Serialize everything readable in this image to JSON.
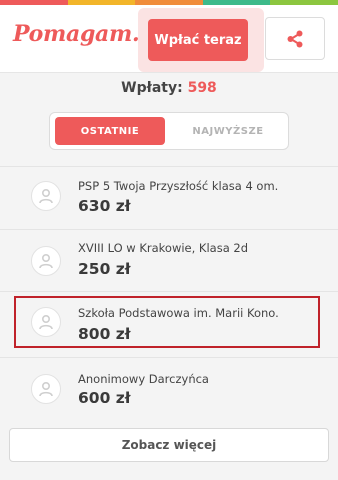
{
  "brand": {
    "logo": "Pomagam.pl",
    "stripe_colors": [
      "#ee5a5a",
      "#f2b52a",
      "#f08c3a",
      "#3dba8a",
      "#8cc63f"
    ]
  },
  "header": {
    "pay_button": "Wpłać teraz",
    "share_icon": "share-icon"
  },
  "summary": {
    "label": "Wpłaty:",
    "count": "598"
  },
  "tabs": [
    {
      "label": "OSTATNIE",
      "active": true
    },
    {
      "label": "NAJWYŻSZE",
      "active": false
    }
  ],
  "donations": [
    {
      "name": "PSP 5 Twoja Przyszłość klasa 4 om...",
      "amount": "630 zł"
    },
    {
      "name": "XVIII LO w Krakowie, Klasa 2d",
      "amount": "250 zł"
    },
    {
      "name": "Szkoła Podstawowa im. Marii Kono...",
      "amount": "800 zł"
    },
    {
      "name": "Anonimowy Darczyńca",
      "amount": "600 zł"
    }
  ],
  "more_button": "Zobacz więcej",
  "colors": {
    "accent": "#ee5a5a",
    "highlight_border": "#c0222a"
  }
}
